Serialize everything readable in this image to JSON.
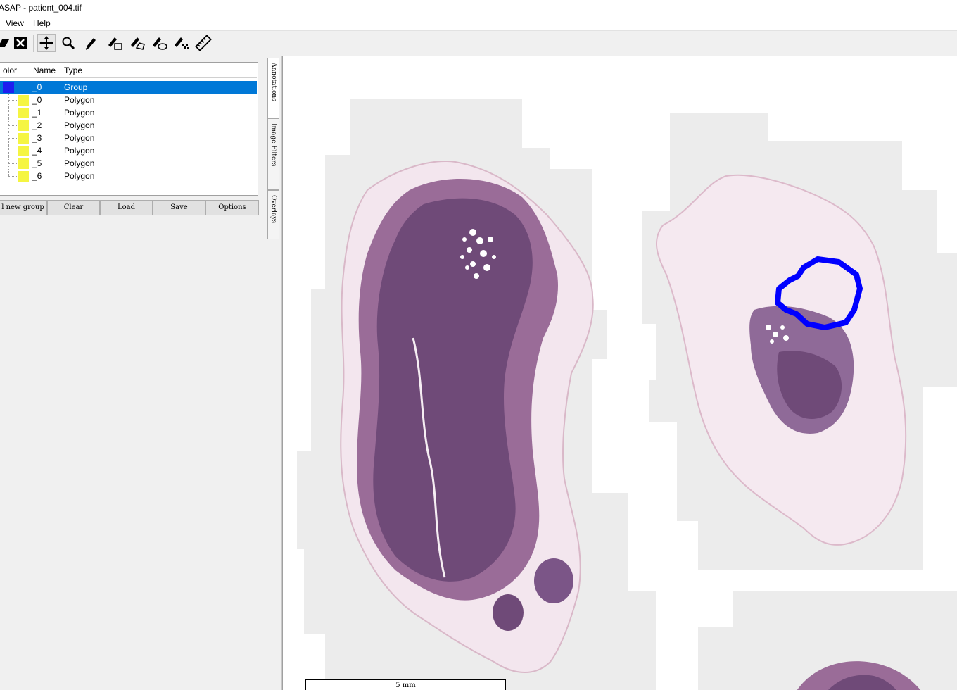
{
  "window": {
    "title": "ASAP - patient_004.tif"
  },
  "menu": {
    "items": [
      "View",
      "Help"
    ]
  },
  "toolbar": {
    "tools": [
      "open-icon",
      "close-icon",
      "pan-icon",
      "zoom-icon",
      "point-icon",
      "rectangle-icon",
      "polygon-icon",
      "spline-icon",
      "measure-icon",
      "ruler-icon"
    ],
    "active_tool": "pan-icon"
  },
  "annotations": {
    "columns": [
      "olor",
      "Name",
      "Type"
    ],
    "rows": [
      {
        "color": "#1e1ef0",
        "name": "_0",
        "type": "Group",
        "selected": true
      },
      {
        "color": "#f5f542",
        "name": "_0",
        "type": "Polygon"
      },
      {
        "color": "#f5f542",
        "name": "_1",
        "type": "Polygon"
      },
      {
        "color": "#f5f542",
        "name": "_2",
        "type": "Polygon"
      },
      {
        "color": "#f5f542",
        "name": "_3",
        "type": "Polygon"
      },
      {
        "color": "#f5f542",
        "name": "_4",
        "type": "Polygon"
      },
      {
        "color": "#f5f542",
        "name": "_5",
        "type": "Polygon"
      },
      {
        "color": "#f5f542",
        "name": "_6",
        "type": "Polygon"
      }
    ],
    "buttons": [
      "l new group",
      "Clear",
      "Load",
      "Save",
      "Options"
    ]
  },
  "side_tabs": [
    "Annotations",
    "Image Filters",
    "Overlays"
  ],
  "viewer": {
    "scale_label": "5 mm",
    "annotation_color": "#0000ff"
  }
}
